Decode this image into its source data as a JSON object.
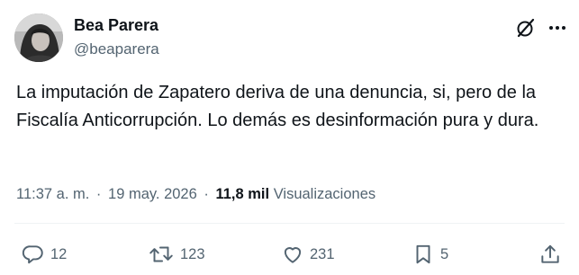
{
  "author": {
    "display_name": "Bea Parera",
    "handle": "@beaparera"
  },
  "tweet": {
    "text": "La imputación de Zapatero deriva de una denuncia, si, pero de la Fiscalía Anticorrupción. Lo demás es desinformación pura y dura."
  },
  "meta": {
    "time": "11:37 a. m.",
    "separator": "·",
    "date": "19 may. 2026",
    "views_count": "11,8 mil",
    "views_label": "Visualizaciones"
  },
  "actions": {
    "replies": "12",
    "reposts": "123",
    "likes": "231",
    "bookmarks": "5"
  },
  "icons": {
    "header": [
      "grok-icon",
      "more-options-icon"
    ],
    "actions": [
      "reply-icon",
      "repost-icon",
      "like-icon",
      "bookmark-icon",
      "share-icon"
    ]
  },
  "colors": {
    "text_primary": "#0f1419",
    "text_secondary": "#536471"
  }
}
